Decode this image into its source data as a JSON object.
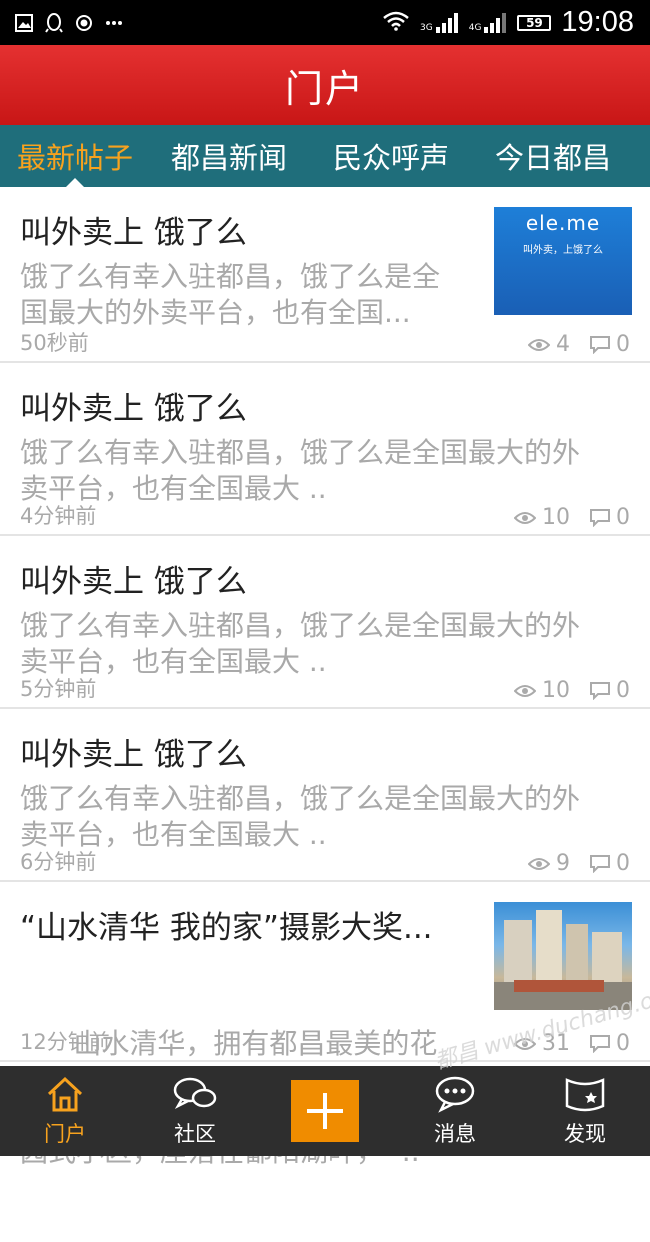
{
  "status_bar": {
    "left_icons": [
      "image-icon",
      "qq-icon",
      "record-icon",
      "more-icon"
    ],
    "net_3g": "3G",
    "net_4g": "4G",
    "battery": "59",
    "time": "19:08"
  },
  "header": {
    "title": "门户"
  },
  "tabs": [
    {
      "label": "最新帖子",
      "active": true
    },
    {
      "label": "都昌新闻",
      "active": false
    },
    {
      "label": "民众呼声",
      "active": false
    },
    {
      "label": "今日都昌",
      "active": false
    }
  ],
  "posts": [
    {
      "title": "叫外卖上   饿了么",
      "summary": [
        "饿了么有幸入驻都昌，饿了么是全",
        "国最大的外卖平台，也有全国..."
      ],
      "time": "50秒前",
      "views": "4",
      "comments": "0",
      "thumb": "ele.me",
      "thumb_slogan": "叫外卖，上饿了么"
    },
    {
      "title": "叫外卖上   饿了么",
      "summary": [
        "饿了么有幸入驻都昌，饿了么是全国最大的外",
        "卖平台，也有全国最大 .."
      ],
      "time": "4分钟前",
      "views": "10",
      "comments": "0"
    },
    {
      "title": "叫外卖上   饿了么",
      "summary": [
        "饿了么有幸入驻都昌，饿了么是全国最大的外",
        "卖平台，也有全国最大 .."
      ],
      "time": "5分钟前",
      "views": "10",
      "comments": "0"
    },
    {
      "title": "叫外卖上   饿了么",
      "summary": [
        "饿了么有幸入驻都昌，饿了么是全国最大的外",
        "卖平台，也有全国最大 .."
      ],
      "time": "6分钟前",
      "views": "9",
      "comments": "0"
    },
    {
      "title": "“山水清华 我的家”摄影大奖...",
      "summary": [
        "      山水清华，拥有都昌最美的花",
        "园式小区，座落在鄱阳湖畔，  .."
      ],
      "time": "12分钟前",
      "views": "31",
      "comments": "0"
    }
  ],
  "bottom_nav": [
    {
      "label": "门户",
      "icon": "home-icon",
      "active": true
    },
    {
      "label": "社区",
      "icon": "chat-bubbles-icon",
      "active": false
    },
    {
      "label": "",
      "icon": "plus-icon",
      "active": false
    },
    {
      "label": "消息",
      "icon": "message-icon",
      "active": false
    },
    {
      "label": "发现",
      "icon": "flag-icon",
      "active": false
    }
  ],
  "watermark": "都昌 www.duchang.org",
  "colors": {
    "header": "#d42020",
    "tabs": "#1f6e7b",
    "accent": "#f7a21e",
    "nav": "#2e2e2e"
  }
}
